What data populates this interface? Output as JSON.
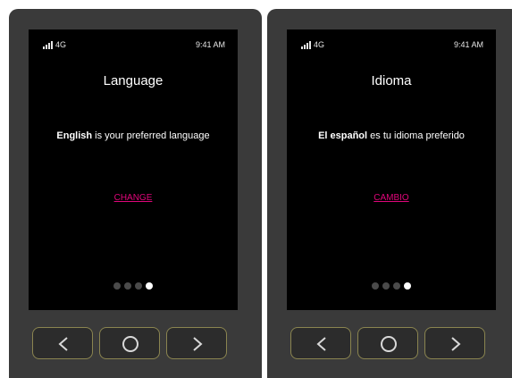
{
  "screens": [
    {
      "status": {
        "network": "4G",
        "time": "9:41 AM"
      },
      "title": "Language",
      "message_bold": "English",
      "message_rest": " is your preferred language",
      "action_label": "CHANGE",
      "pagination": {
        "total": 4,
        "active": 4
      }
    },
    {
      "status": {
        "network": "4G",
        "time": "9:41 AM"
      },
      "title": "Idioma",
      "message_bold": "El español",
      "message_rest": " es tu idioma preferido",
      "action_label": "CAMBIO",
      "pagination": {
        "total": 4,
        "active": 4
      }
    }
  ],
  "nav_buttons": [
    "chevron-left-icon",
    "circle-icon",
    "chevron-right-icon"
  ],
  "colors": {
    "device": "#3a3a3a",
    "screen": "#000000",
    "accent_link": "#e0067a",
    "button_border": "#8a8450"
  }
}
